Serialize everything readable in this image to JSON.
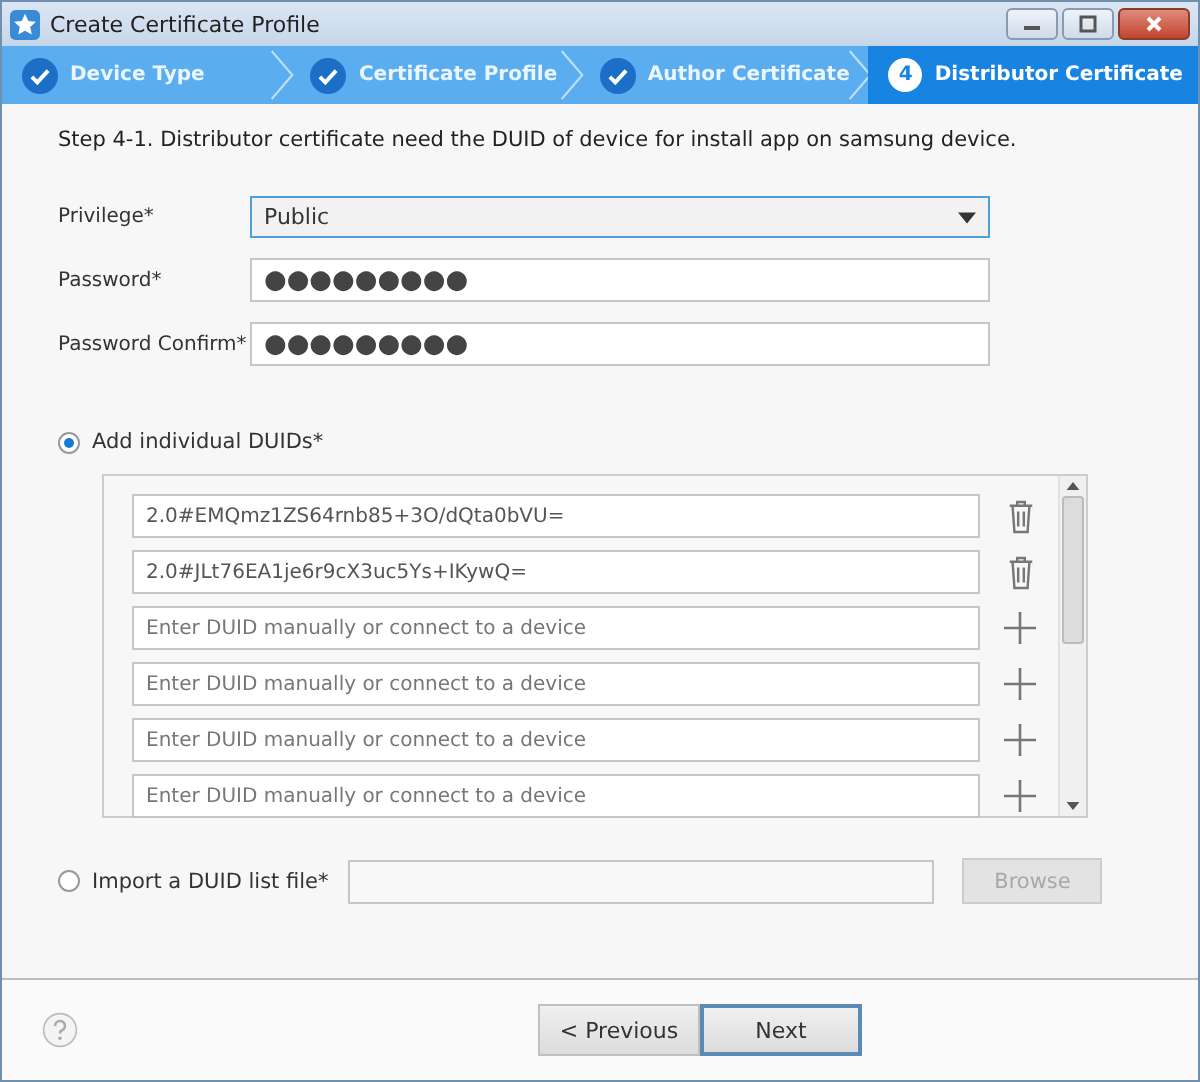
{
  "window": {
    "title": "Create Certificate Profile"
  },
  "steps": [
    {
      "label": "Device Type",
      "completed": true,
      "selected": false
    },
    {
      "label": "Certificate Profile",
      "completed": true,
      "selected": false
    },
    {
      "label": "Author Certificate",
      "completed": true,
      "selected": false
    },
    {
      "label": "Distributor Certificate",
      "completed": false,
      "selected": true,
      "number": "4"
    }
  ],
  "instruction": "Step 4-1. Distributor certificate need the DUID of device for install app on samsung device.",
  "fields": [
    {
      "label": "Privilege*",
      "kind": "dropdown",
      "value": "Public"
    },
    {
      "label": "Password*",
      "kind": "password",
      "value": "●●●●●●●●●"
    },
    {
      "label": "Password Confirm*",
      "kind": "password",
      "value": "●●●●●●●●●"
    }
  ],
  "duid_option": {
    "label": "Add individual DUIDs*",
    "selected": true
  },
  "duids": [
    {
      "kind": "entry",
      "value": "2.0#EMQmz1ZS64rnb85+3O/dQta0bVU="
    },
    {
      "kind": "entry",
      "value": "2.0#JLt76EA1je6r9cX3uc5Ys+IKywQ="
    },
    {
      "kind": "empty",
      "placeholder": "Enter DUID manually or connect to a device"
    },
    {
      "kind": "empty",
      "placeholder": "Enter DUID manually or connect to a device"
    },
    {
      "kind": "empty",
      "placeholder": "Enter DUID manually or connect to a device"
    },
    {
      "kind": "empty",
      "placeholder": "Enter DUID manually or connect to a device"
    }
  ],
  "import_option": {
    "label": "Import a DUID list file*",
    "selected": false,
    "browse_button": "Browse",
    "browse_disabled": true
  },
  "footer": {
    "buttons": [
      "< Previous",
      "Next"
    ]
  }
}
